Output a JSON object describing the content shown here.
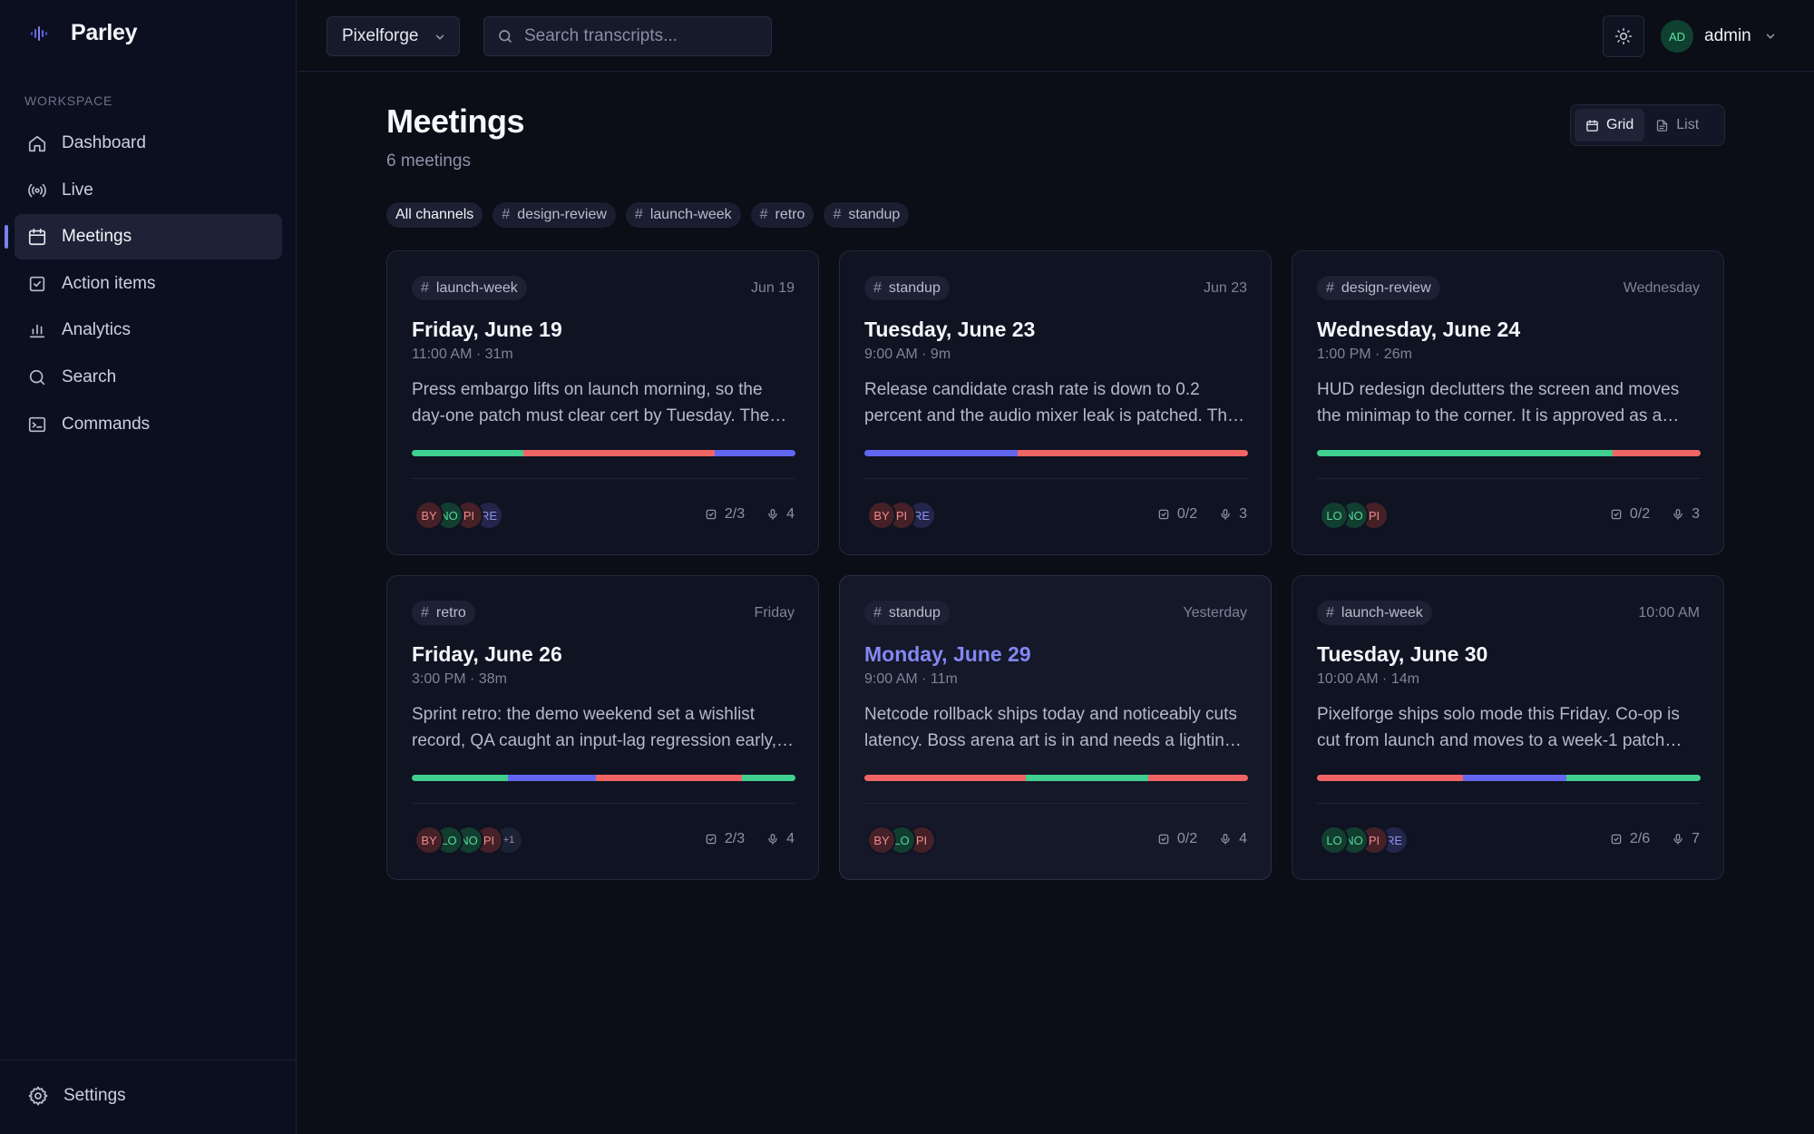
{
  "app": {
    "name": "Parley",
    "logo_icon": "waveform-icon"
  },
  "sidebar": {
    "section_label": "WORKSPACE",
    "items": [
      {
        "label": "Dashboard",
        "icon": "home-icon",
        "active": false
      },
      {
        "label": "Live",
        "icon": "broadcast-icon",
        "active": false
      },
      {
        "label": "Meetings",
        "icon": "calendar-icon",
        "active": true
      },
      {
        "label": "Action items",
        "icon": "checkbox-icon",
        "active": false
      },
      {
        "label": "Analytics",
        "icon": "bar-chart-icon",
        "active": false
      },
      {
        "label": "Search",
        "icon": "search-icon",
        "active": false
      },
      {
        "label": "Commands",
        "icon": "terminal-icon",
        "active": false
      }
    ],
    "settings_label": "Settings"
  },
  "topbar": {
    "org": "Pixelforge",
    "search_placeholder": "Search transcripts...",
    "user_initials": "AD",
    "user_name": "admin"
  },
  "page": {
    "title": "Meetings",
    "subtitle": "6 meetings",
    "view_toggle": {
      "grid_label": "Grid",
      "list_label": "List",
      "selected": "Grid"
    },
    "channels": [
      "All channels",
      "design-review",
      "launch-week",
      "retro",
      "standup"
    ]
  },
  "colors": {
    "accent": "#7b7ff0",
    "green": "#3fcf8e",
    "red": "#f06464",
    "blue": "#6366f1"
  },
  "meetings": [
    {
      "channel": "launch-week",
      "when": "Jun 19",
      "title": "Friday, June 19",
      "meta": "11:00 AM · 31m",
      "summary": "Press embargo lifts on launch morning, so the day-one patch must clear cert by Tuesday. The patch is on track.",
      "segments": [
        {
          "color": "green",
          "share": 0.29
        },
        {
          "color": "red",
          "share": 0.5
        },
        {
          "color": "blue",
          "share": 0.21
        }
      ],
      "participants": [
        {
          "initials": "BY",
          "tone": "red"
        },
        {
          "initials": "NO",
          "tone": "green"
        },
        {
          "initials": "PI",
          "tone": "red"
        },
        {
          "initials": "RE",
          "tone": "blue"
        }
      ],
      "actions": "2/3",
      "speakers": "4",
      "highlight": false
    },
    {
      "channel": "standup",
      "when": "Jun 23",
      "title": "Tuesday, June 23",
      "meta": "9:00 AM · 9m",
      "summary": "Release candidate crash rate is down to 0.2 percent and the audio mixer leak is patched. The build is green.",
      "segments": [
        {
          "color": "blue",
          "share": 0.4
        },
        {
          "color": "red",
          "share": 0.6
        }
      ],
      "participants": [
        {
          "initials": "BY",
          "tone": "red"
        },
        {
          "initials": "PI",
          "tone": "red"
        },
        {
          "initials": "RE",
          "tone": "blue"
        }
      ],
      "actions": "0/2",
      "speakers": "3",
      "highlight": false
    },
    {
      "channel": "design-review",
      "when": "Wednesday",
      "title": "Wednesday, June 24",
      "meta": "1:00 PM · 26m",
      "summary": "HUD redesign declutters the screen and moves the minimap to the corner. It is approved as a post-launch update.",
      "segments": [
        {
          "color": "green",
          "share": 0.46
        },
        {
          "color": "green",
          "share": 0.31
        },
        {
          "color": "red",
          "share": 0.23
        }
      ],
      "participants": [
        {
          "initials": "LO",
          "tone": "green"
        },
        {
          "initials": "NO",
          "tone": "green"
        },
        {
          "initials": "PI",
          "tone": "red"
        }
      ],
      "actions": "0/2",
      "speakers": "3",
      "highlight": false
    },
    {
      "channel": "retro",
      "when": "Friday",
      "title": "Friday, June 26",
      "meta": "3:00 PM · 38m",
      "summary": "Sprint retro: the demo weekend set a wishlist record, QA caught an input-lag regression early, and crunch stayed low.",
      "segments": [
        {
          "color": "green",
          "share": 0.25
        },
        {
          "color": "blue",
          "share": 0.23
        },
        {
          "color": "red",
          "share": 0.38
        },
        {
          "color": "green",
          "share": 0.14
        }
      ],
      "participants": [
        {
          "initials": "BY",
          "tone": "red"
        },
        {
          "initials": "LO",
          "tone": "green"
        },
        {
          "initials": "NO",
          "tone": "green"
        },
        {
          "initials": "PI",
          "tone": "red"
        },
        {
          "initials": "+1",
          "tone": "more"
        }
      ],
      "actions": "2/3",
      "speakers": "4",
      "highlight": false
    },
    {
      "channel": "standup",
      "when": "Yesterday",
      "title": "Monday, June 29",
      "meta": "9:00 AM · 11m",
      "summary": "Netcode rollback ships today and noticeably cuts latency. Boss arena art is in and needs a lighting pass.",
      "segments": [
        {
          "color": "red",
          "share": 0.42
        },
        {
          "color": "green",
          "share": 0.32
        },
        {
          "color": "red",
          "share": 0.26
        }
      ],
      "participants": [
        {
          "initials": "BY",
          "tone": "red"
        },
        {
          "initials": "LO",
          "tone": "green"
        },
        {
          "initials": "PI",
          "tone": "red"
        }
      ],
      "actions": "0/2",
      "speakers": "4",
      "highlight": true
    },
    {
      "channel": "launch-week",
      "when": "10:00 AM",
      "title": "Tuesday, June 30",
      "meta": "10:00 AM · 14m",
      "summary": "Pixelforge ships solo mode this Friday. Co-op is cut from launch and moves to a week-1 patch after a stability review.",
      "segments": [
        {
          "color": "red",
          "share": 0.38
        },
        {
          "color": "blue",
          "share": 0.27
        },
        {
          "color": "green",
          "share": 0.2
        },
        {
          "color": "green",
          "share": 0.15
        }
      ],
      "participants": [
        {
          "initials": "LO",
          "tone": "green"
        },
        {
          "initials": "NO",
          "tone": "green"
        },
        {
          "initials": "PI",
          "tone": "red"
        },
        {
          "initials": "RE",
          "tone": "blue"
        }
      ],
      "actions": "2/6",
      "speakers": "7",
      "highlight": false
    }
  ]
}
